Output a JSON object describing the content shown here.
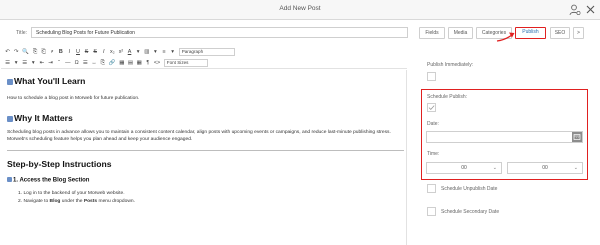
{
  "window": {
    "title": "Add New Post"
  },
  "post": {
    "title_label": "Title:",
    "title_value": "Scheduling Blog Posts for Future Publication"
  },
  "tabs": [
    {
      "label": "Fields"
    },
    {
      "label": "Media"
    },
    {
      "label": "Categories"
    },
    {
      "label": "Publish",
      "active": true
    },
    {
      "label": "SEO"
    },
    {
      "label": ">"
    }
  ],
  "toolbar": {
    "row1": [
      "↶",
      "↷",
      "🔍",
      "⎘",
      "⎗",
      "⎖",
      "B",
      "I",
      "U",
      "S",
      "S",
      "I",
      "x₂",
      "x²",
      "A",
      "▾",
      "▥",
      "▾",
      "≡",
      "▾"
    ],
    "paragraph_select": "Paragraph",
    "row2": [
      "☰",
      "▾",
      "☰",
      "▾",
      "⇤",
      "⇥",
      "“",
      "—",
      "Ω",
      "☰",
      "↔",
      "⎘",
      "🔗",
      "▦",
      "▤",
      "▦",
      "¶",
      "<>"
    ],
    "fontsize_select": "Font Sizes"
  },
  "content": {
    "h_learn": "What You'll Learn",
    "p_learn": "How to schedule a blog post in Morweb for future publication.",
    "h_why": "Why It Matters",
    "p_why": "Scheduling blog posts in advance allows you to maintain a consistent content calendar, align posts with upcoming events or campaigns, and reduce last-minute publishing stress. Morweb's scheduling feature helps you plan ahead and keep your audience engaged.",
    "h_steps": "Step-by-Step Instructions",
    "h_access": "1. Access the Blog Section",
    "li1": "1. Log in to the backend of your Morweb website.",
    "li2_pre": "2. Navigate to ",
    "li2_blog": "Blog",
    "li2_mid": " under the ",
    "li2_posts": "Posts",
    "li2_post": " menu dropdown."
  },
  "publish_panel": {
    "publish_immediately_label": "Publish Immediately:",
    "schedule_publish_label": "Schedule Publish:",
    "schedule_publish_checked": true,
    "date_label": "Date:",
    "date_value": "",
    "time_label": "Time:",
    "time_hour": "00",
    "time_minute": "00",
    "schedule_unpublish_label": "Schedule Unpublish Date",
    "schedule_secondary_label": "Schedule Secondary Date"
  },
  "colors": {
    "highlight": "#e02020",
    "active_tab_text": "#2a6fb0"
  }
}
